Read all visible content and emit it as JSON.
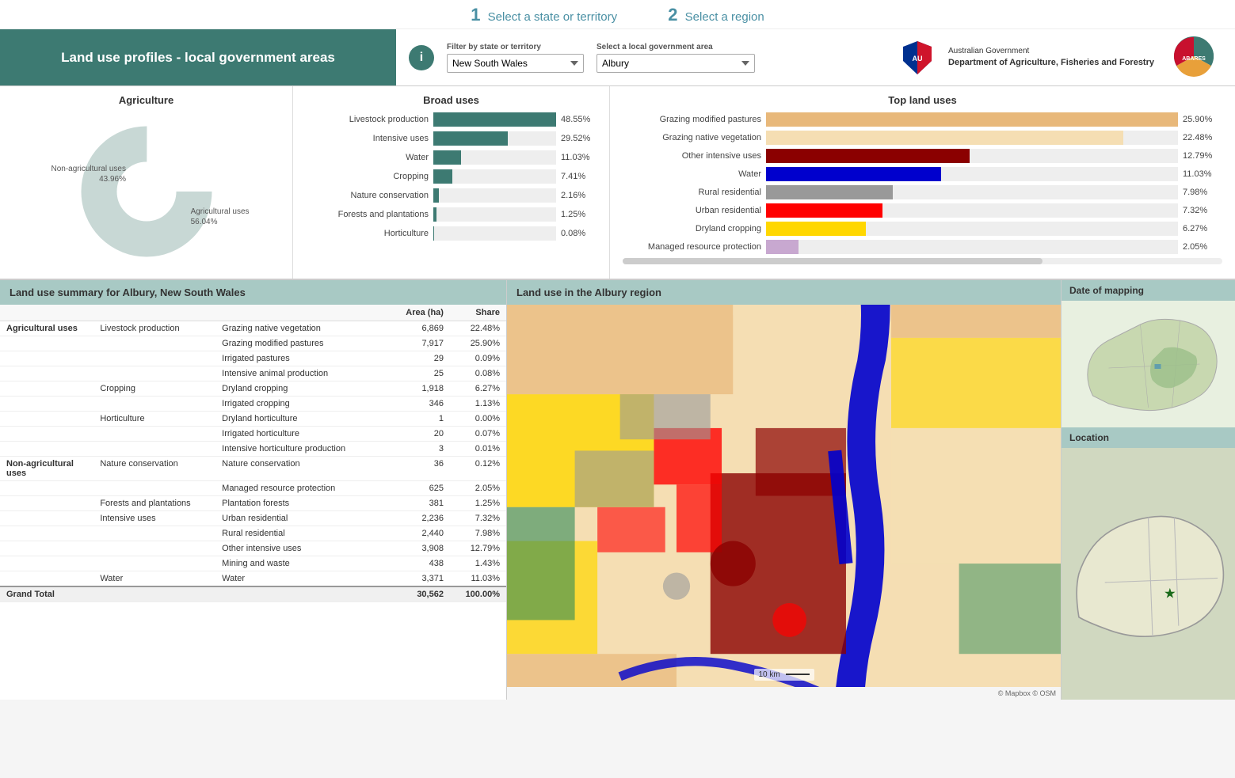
{
  "instructions": {
    "step1_num": "1",
    "step1_text": "Select a state or territory",
    "step2_num": "2",
    "step2_text": "Select a region"
  },
  "header": {
    "title": "Land use profiles - local government areas",
    "info_icon": "i",
    "filter_state_label": "Filter by state or territory",
    "filter_state_value": "New South Wales",
    "filter_region_label": "Select a local government area",
    "filter_region_value": "Albury",
    "gov_name": "Australian Government",
    "dept_name": "Department of Agriculture, Fisheries and Forestry",
    "abares_label": "ABARES"
  },
  "agriculture": {
    "title": "Agriculture",
    "non_agri_label": "Non-agricultural uses",
    "non_agri_pct": "43.96%",
    "agri_label": "Agricultural uses",
    "agri_pct": "56.04%"
  },
  "broad_uses": {
    "title": "Broad uses",
    "items": [
      {
        "label": "Livestock production",
        "value": "48.55%",
        "pct": 48.55
      },
      {
        "label": "Intensive uses",
        "value": "29.52%",
        "pct": 29.52
      },
      {
        "label": "Water",
        "value": "11.03%",
        "pct": 11.03
      },
      {
        "label": "Cropping",
        "value": "7.41%",
        "pct": 7.41
      },
      {
        "label": "Nature conservation",
        "value": "2.16%",
        "pct": 2.16
      },
      {
        "label": "Forests and plantations",
        "value": "1.25%",
        "pct": 1.25
      },
      {
        "label": "Horticulture",
        "value": "0.08%",
        "pct": 0.08
      }
    ]
  },
  "top_uses": {
    "title": "Top land uses",
    "items": [
      {
        "label": "Grazing modified pastures",
        "value": "25.90%",
        "pct": 25.9,
        "color": "#e8b87a"
      },
      {
        "label": "Grazing native vegetation",
        "value": "22.48%",
        "pct": 22.48,
        "color": "#f5deb3"
      },
      {
        "label": "Other intensive uses",
        "value": "12.79%",
        "pct": 12.79,
        "color": "#8b0000"
      },
      {
        "label": "Water",
        "value": "11.03%",
        "pct": 11.03,
        "color": "#0000cd"
      },
      {
        "label": "Rural residential",
        "value": "7.98%",
        "pct": 7.98,
        "color": "#999999"
      },
      {
        "label": "Urban residential",
        "value": "7.32%",
        "pct": 7.32,
        "color": "#ff0000"
      },
      {
        "label": "Dryland cropping",
        "value": "6.27%",
        "pct": 6.27,
        "color": "#ffd700"
      },
      {
        "label": "Managed resource protection",
        "value": "2.05%",
        "pct": 2.05,
        "color": "#c8a8d0"
      }
    ]
  },
  "summary": {
    "title": "Land use summary for Albury, New South Wales",
    "col_area": "Area (ha)",
    "col_share": "Share",
    "rows": [
      {
        "cat1": "Agricultural uses",
        "cat2": "Livestock production",
        "cat3": "Grazing native vegetation",
        "area": "6,869",
        "share": "22.48%"
      },
      {
        "cat1": "",
        "cat2": "",
        "cat3": "Grazing modified pastures",
        "area": "7,917",
        "share": "25.90%"
      },
      {
        "cat1": "",
        "cat2": "",
        "cat3": "Irrigated pastures",
        "area": "29",
        "share": "0.09%"
      },
      {
        "cat1": "",
        "cat2": "",
        "cat3": "Intensive animal production",
        "area": "25",
        "share": "0.08%"
      },
      {
        "cat1": "",
        "cat2": "Cropping",
        "cat3": "Dryland cropping",
        "area": "1,918",
        "share": "6.27%"
      },
      {
        "cat1": "",
        "cat2": "",
        "cat3": "Irrigated cropping",
        "area": "346",
        "share": "1.13%"
      },
      {
        "cat1": "",
        "cat2": "Horticulture",
        "cat3": "Dryland horticulture",
        "area": "1",
        "share": "0.00%"
      },
      {
        "cat1": "",
        "cat2": "",
        "cat3": "Irrigated horticulture",
        "area": "20",
        "share": "0.07%"
      },
      {
        "cat1": "",
        "cat2": "",
        "cat3": "Intensive horticulture production",
        "area": "3",
        "share": "0.01%"
      },
      {
        "cat1": "Non-agricultural uses",
        "cat2": "Nature conservation",
        "cat3": "Nature conservation",
        "area": "36",
        "share": "0.12%"
      },
      {
        "cat1": "",
        "cat2": "",
        "cat3": "Managed resource protection",
        "area": "625",
        "share": "2.05%"
      },
      {
        "cat1": "",
        "cat2": "Forests and plantations",
        "cat3": "Plantation forests",
        "area": "381",
        "share": "1.25%"
      },
      {
        "cat1": "",
        "cat2": "Intensive uses",
        "cat3": "Urban residential",
        "area": "2,236",
        "share": "7.32%"
      },
      {
        "cat1": "",
        "cat2": "",
        "cat3": "Rural residential",
        "area": "2,440",
        "share": "7.98%"
      },
      {
        "cat1": "",
        "cat2": "",
        "cat3": "Other intensive uses",
        "area": "3,908",
        "share": "12.79%"
      },
      {
        "cat1": "",
        "cat2": "",
        "cat3": "Mining and waste",
        "area": "438",
        "share": "1.43%"
      },
      {
        "cat1": "",
        "cat2": "Water",
        "cat3": "Water",
        "area": "3,371",
        "share": "11.03%"
      },
      {
        "cat1": "Grand Total",
        "cat2": "",
        "cat3": "",
        "area": "30,562",
        "share": "100.00%"
      }
    ]
  },
  "map": {
    "title": "Land use in the Albury region",
    "scale_label": "10 km",
    "credit": "© Mapbox © OSM"
  },
  "side": {
    "date_mapping_title": "Date of mapping",
    "location_title": "Location"
  }
}
